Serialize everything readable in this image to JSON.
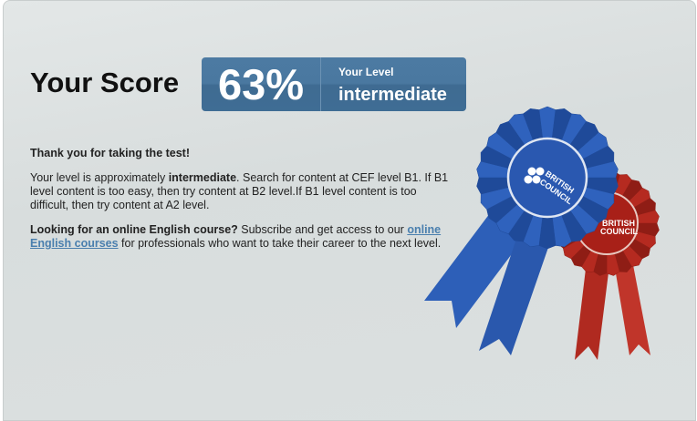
{
  "score": {
    "title": "Your Score",
    "percent": "63%",
    "level_label": "Your Level",
    "level_value": "intermediate"
  },
  "message": {
    "thanks": "Thank you for taking the test!",
    "level_prefix": "Your level is approximately ",
    "level_bold": "intermediate",
    "level_suffix": ". Search for content at CEF level B1. If B1 level content is too easy, then try content at B2 level.If B1 level content is too difficult, then try content at A2 level.",
    "course_bold": "Looking for an online English course?",
    "course_text": " Subscribe and get access to our ",
    "course_link": "online English courses",
    "course_suffix": " for professionals who want to take their career to the next level."
  },
  "badge": {
    "logo_line1": "BRITISH",
    "logo_line2": "COUNCIL"
  },
  "colors": {
    "score_box": "#4a78a0",
    "link": "#4a7fae",
    "blue_ribbon": "#2a5bb5",
    "red_ribbon": "#b8281e"
  }
}
